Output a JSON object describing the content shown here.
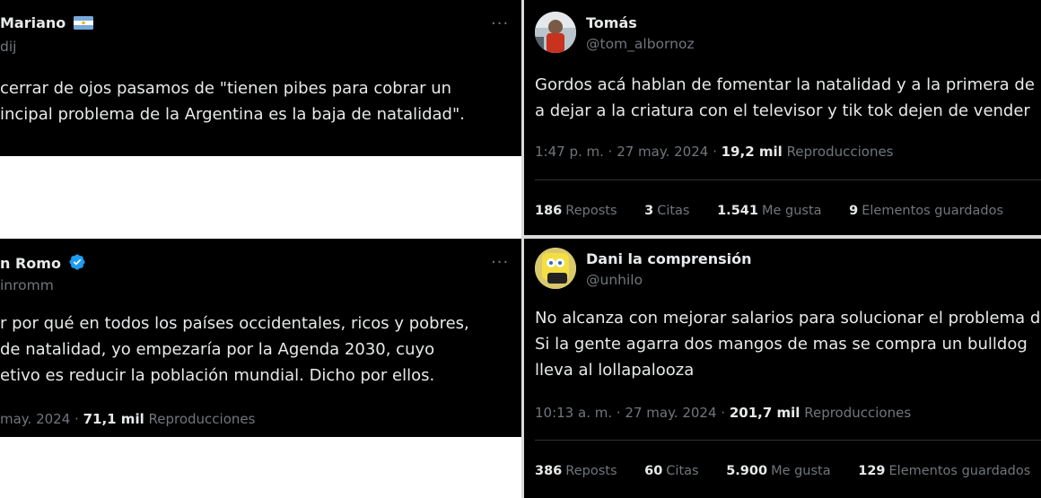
{
  "tweets": [
    {
      "name": "Mariano",
      "flag_emoji": "🇦🇷",
      "handle": "dij",
      "more": "···",
      "lines": [
        "cerrar de ojos pasamos de \"tienen pibes para cobrar un",
        "incipal problema de la Argentina es la baja de natalidad\"."
      ]
    },
    {
      "name": "n Romo",
      "verified": true,
      "handle": "inromm",
      "more": "···",
      "lines": [
        "r por qué en todos los países occidentales, ricos y pobres,",
        "de natalidad, yo empezaría por la Agenda 2030, cuyo",
        "etivo es reducir la población mundial. Dicho por ellos."
      ],
      "meta_prefix": "may. 2024 ·",
      "views_value": "71,1 mil",
      "views_label": "Reproducciones"
    },
    {
      "name": "Tomás",
      "handle": "@tom_albornoz",
      "lines": [
        "Gordos acá hablan de fomentar la natalidad y a la primera de",
        "a dejar a la criatura con el televisor y tik tok dejen de vender"
      ],
      "meta_prefix": "1:47 p. m. · 27 may. 2024 ·",
      "views_value": "19,2 mil",
      "views_label": "Reproducciones",
      "stats": [
        {
          "value": "186",
          "label": "Reposts"
        },
        {
          "value": "3",
          "label": "Citas"
        },
        {
          "value": "1.541",
          "label": "Me gusta"
        },
        {
          "value": "9",
          "label": "Elementos guardados"
        }
      ]
    },
    {
      "name": "Dani la comprensión",
      "handle": "@unhilo",
      "lines": [
        "No alcanza con mejorar salarios para solucionar el problema d",
        "Si la gente agarra dos mangos de mas se compra un bulldog",
        "lleva al lollapalooza"
      ],
      "meta_prefix": "10:13 a. m. · 27 may. 2024 ·",
      "views_value": "201,7 mil",
      "views_label": "Reproducciones",
      "stats": [
        {
          "value": "386",
          "label": "Reposts"
        },
        {
          "value": "60",
          "label": "Citas"
        },
        {
          "value": "5.900",
          "label": "Me gusta"
        },
        {
          "value": "129",
          "label": "Elementos guardados"
        }
      ]
    }
  ],
  "colors": {
    "background": "#000000",
    "text": "#e7e9ea",
    "muted": "#71767b",
    "verified": "#1d9bf0"
  }
}
